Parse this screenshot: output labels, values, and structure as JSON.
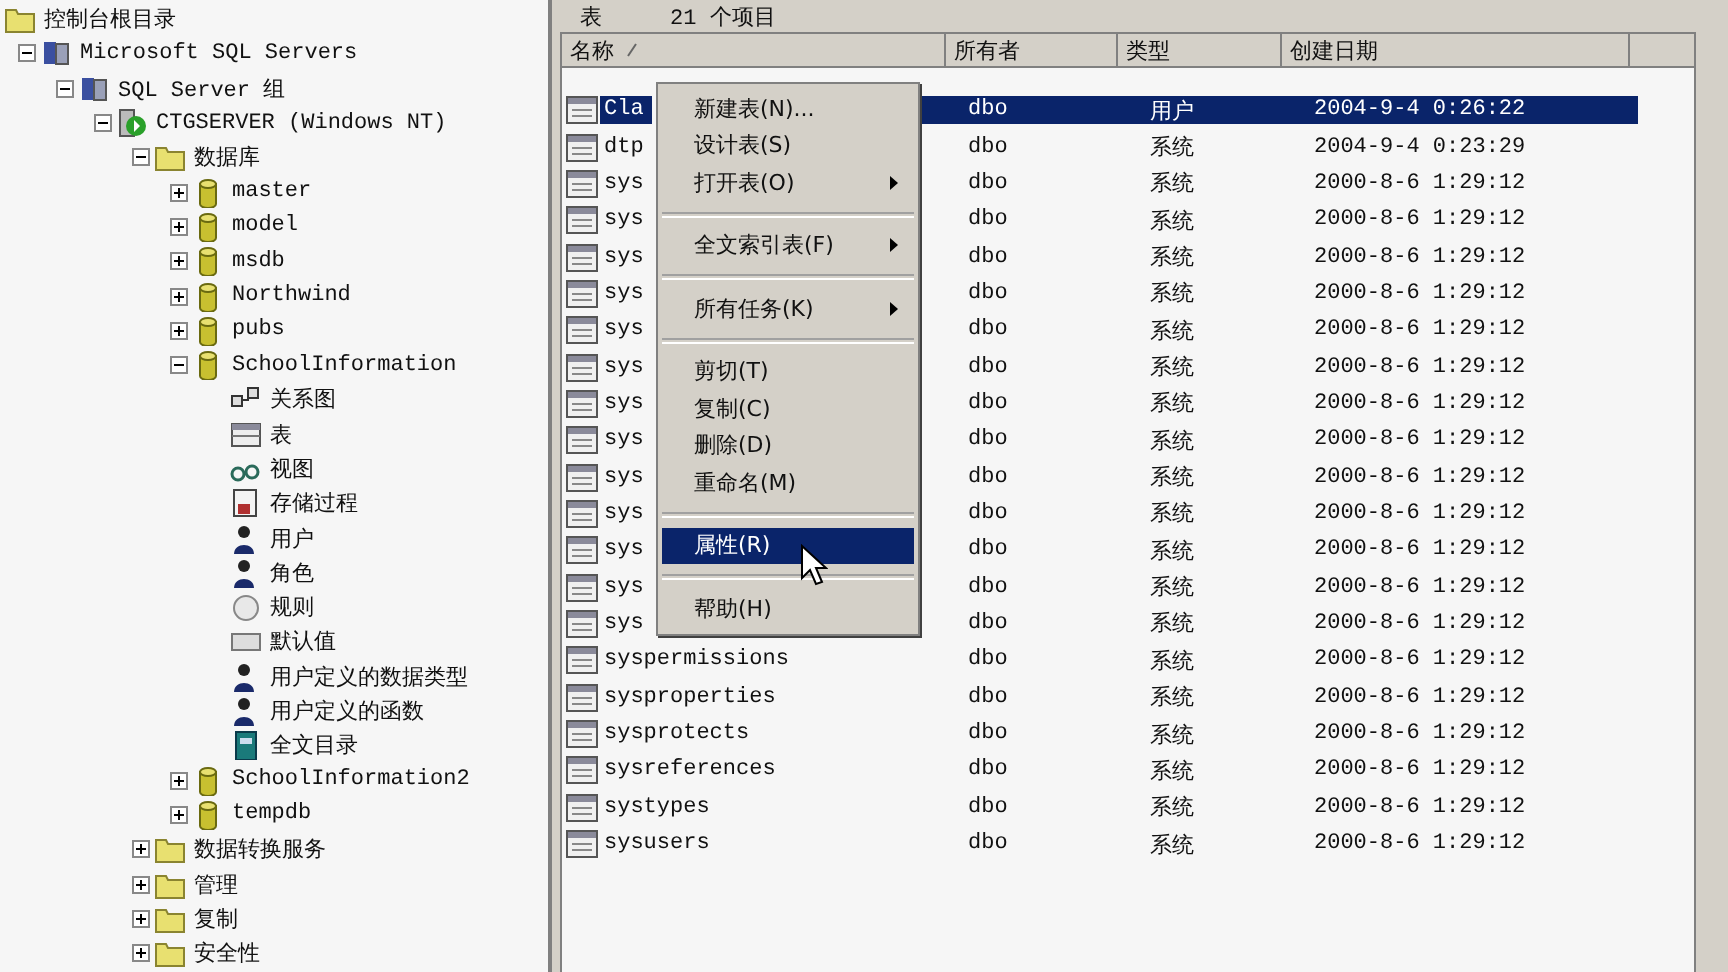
{
  "tree": {
    "label": "控制台根目录",
    "kind": "folder",
    "children": [
      {
        "label": "Microsoft SQL Servers",
        "kind": "server-group",
        "expanded": true,
        "children": [
          {
            "label": "SQL Server 组",
            "kind": "server-group",
            "expanded": true,
            "children": [
              {
                "label": "CTGSERVER (Windows NT)",
                "kind": "server",
                "expanded": true,
                "children": [
                  {
                    "label": "数据库",
                    "kind": "folder",
                    "expanded": true,
                    "children": [
                      {
                        "label": "master",
                        "kind": "database",
                        "expanded": false
                      },
                      {
                        "label": "model",
                        "kind": "database",
                        "expanded": false
                      },
                      {
                        "label": "msdb",
                        "kind": "database",
                        "expanded": false
                      },
                      {
                        "label": "Northwind",
                        "kind": "database",
                        "expanded": false
                      },
                      {
                        "label": "pubs",
                        "kind": "database",
                        "expanded": false
                      },
                      {
                        "label": "SchoolInformation",
                        "kind": "database",
                        "expanded": true,
                        "children": [
                          {
                            "label": "关系图",
                            "kind": "diagram"
                          },
                          {
                            "label": "表",
                            "kind": "table"
                          },
                          {
                            "label": "视图",
                            "kind": "view"
                          },
                          {
                            "label": "存储过程",
                            "kind": "procedure"
                          },
                          {
                            "label": "用户",
                            "kind": "user"
                          },
                          {
                            "label": "角色",
                            "kind": "user"
                          },
                          {
                            "label": "规则",
                            "kind": "rule"
                          },
                          {
                            "label": "默认值",
                            "kind": "default"
                          },
                          {
                            "label": "用户定义的数据类型",
                            "kind": "user"
                          },
                          {
                            "label": "用户定义的函数",
                            "kind": "user"
                          },
                          {
                            "label": "全文目录",
                            "kind": "catalog"
                          }
                        ]
                      },
                      {
                        "label": "SchoolInformation2",
                        "kind": "database",
                        "expanded": false
                      },
                      {
                        "label": "tempdb",
                        "kind": "database",
                        "expanded": false
                      }
                    ]
                  },
                  {
                    "label": "数据转换服务",
                    "kind": "folder",
                    "expanded": false
                  },
                  {
                    "label": "管理",
                    "kind": "folder",
                    "expanded": false
                  },
                  {
                    "label": "复制",
                    "kind": "folder",
                    "expanded": false
                  },
                  {
                    "label": "安全性",
                    "kind": "folder",
                    "expanded": false
                  }
                ]
              }
            ]
          }
        ]
      }
    ]
  },
  "pane_header": {
    "title": "表",
    "count": "21 个项目"
  },
  "table": {
    "columns": [
      {
        "label": "名称",
        "sorted": true
      },
      {
        "label": "所有者",
        "sorted": false
      },
      {
        "label": "类型",
        "sorted": false
      },
      {
        "label": "创建日期",
        "sorted": false
      }
    ],
    "rows": [
      {
        "name": "Cla",
        "owner": "dbo",
        "type": "用户",
        "created": "2004-9-4 0:26:22",
        "selected": true
      },
      {
        "name": "dtp",
        "owner": "dbo",
        "type": "系统",
        "created": "2004-9-4 0:23:29",
        "selected": false
      },
      {
        "name": "sys",
        "owner": "dbo",
        "type": "系统",
        "created": "2000-8-6 1:29:12",
        "selected": false
      },
      {
        "name": "sys",
        "owner": "dbo",
        "type": "系统",
        "created": "2000-8-6 1:29:12",
        "selected": false
      },
      {
        "name": "sys",
        "owner": "dbo",
        "type": "系统",
        "created": "2000-8-6 1:29:12",
        "selected": false
      },
      {
        "name": "sys",
        "owner": "dbo",
        "type": "系统",
        "created": "2000-8-6 1:29:12",
        "selected": false
      },
      {
        "name": "sys",
        "owner": "dbo",
        "type": "系统",
        "created": "2000-8-6 1:29:12",
        "selected": false
      },
      {
        "name": "sys",
        "owner": "dbo",
        "type": "系统",
        "created": "2000-8-6 1:29:12",
        "selected": false
      },
      {
        "name": "sys",
        "owner": "dbo",
        "type": "系统",
        "created": "2000-8-6 1:29:12",
        "selected": false
      },
      {
        "name": "sys",
        "owner": "dbo",
        "type": "系统",
        "created": "2000-8-6 1:29:12",
        "selected": false
      },
      {
        "name": "sys",
        "owner": "dbo",
        "type": "系统",
        "created": "2000-8-6 1:29:12",
        "selected": false
      },
      {
        "name": "sys",
        "owner": "dbo",
        "type": "系统",
        "created": "2000-8-6 1:29:12",
        "selected": false
      },
      {
        "name": "sys",
        "owner": "dbo",
        "type": "系统",
        "created": "2000-8-6 1:29:12",
        "selected": false
      },
      {
        "name": "sys",
        "owner": "dbo",
        "type": "系统",
        "created": "2000-8-6 1:29:12",
        "selected": false
      },
      {
        "name": "sys",
        "owner": "dbo",
        "type": "系统",
        "created": "2000-8-6 1:29:12",
        "selected": false
      },
      {
        "name": "syspermissions",
        "owner": "dbo",
        "type": "系统",
        "created": "2000-8-6 1:29:12",
        "selected": false
      },
      {
        "name": "sysproperties",
        "owner": "dbo",
        "type": "系统",
        "created": "2000-8-6 1:29:12",
        "selected": false
      },
      {
        "name": "sysprotects",
        "owner": "dbo",
        "type": "系统",
        "created": "2000-8-6 1:29:12",
        "selected": false
      },
      {
        "name": "sysreferences",
        "owner": "dbo",
        "type": "系统",
        "created": "2000-8-6 1:29:12",
        "selected": false
      },
      {
        "name": "systypes",
        "owner": "dbo",
        "type": "系统",
        "created": "2000-8-6 1:29:12",
        "selected": false
      },
      {
        "name": "sysusers",
        "owner": "dbo",
        "type": "系统",
        "created": "2000-8-6 1:29:12",
        "selected": false
      }
    ]
  },
  "context_menu": {
    "items": [
      {
        "kind": "item",
        "label": "新建表(N)...",
        "submenu": false,
        "selected": false
      },
      {
        "kind": "item",
        "label": "设计表(S)",
        "submenu": false,
        "selected": false
      },
      {
        "kind": "item",
        "label": "打开表(O)",
        "submenu": true,
        "selected": false
      },
      {
        "kind": "separator"
      },
      {
        "kind": "item",
        "label": "全文索引表(F)",
        "submenu": true,
        "selected": false
      },
      {
        "kind": "separator"
      },
      {
        "kind": "item",
        "label": "所有任务(K)",
        "submenu": true,
        "selected": false
      },
      {
        "kind": "separator"
      },
      {
        "kind": "item",
        "label": "剪切(T)",
        "submenu": false,
        "selected": false
      },
      {
        "kind": "item",
        "label": "复制(C)",
        "submenu": false,
        "selected": false
      },
      {
        "kind": "item",
        "label": "删除(D)",
        "submenu": false,
        "selected": false
      },
      {
        "kind": "item",
        "label": "重命名(M)",
        "submenu": false,
        "selected": false
      },
      {
        "kind": "separator"
      },
      {
        "kind": "item",
        "label": "属性(R)",
        "submenu": false,
        "selected": true
      },
      {
        "kind": "separator"
      },
      {
        "kind": "item",
        "label": "帮助(H)",
        "submenu": false,
        "selected": false
      }
    ]
  }
}
